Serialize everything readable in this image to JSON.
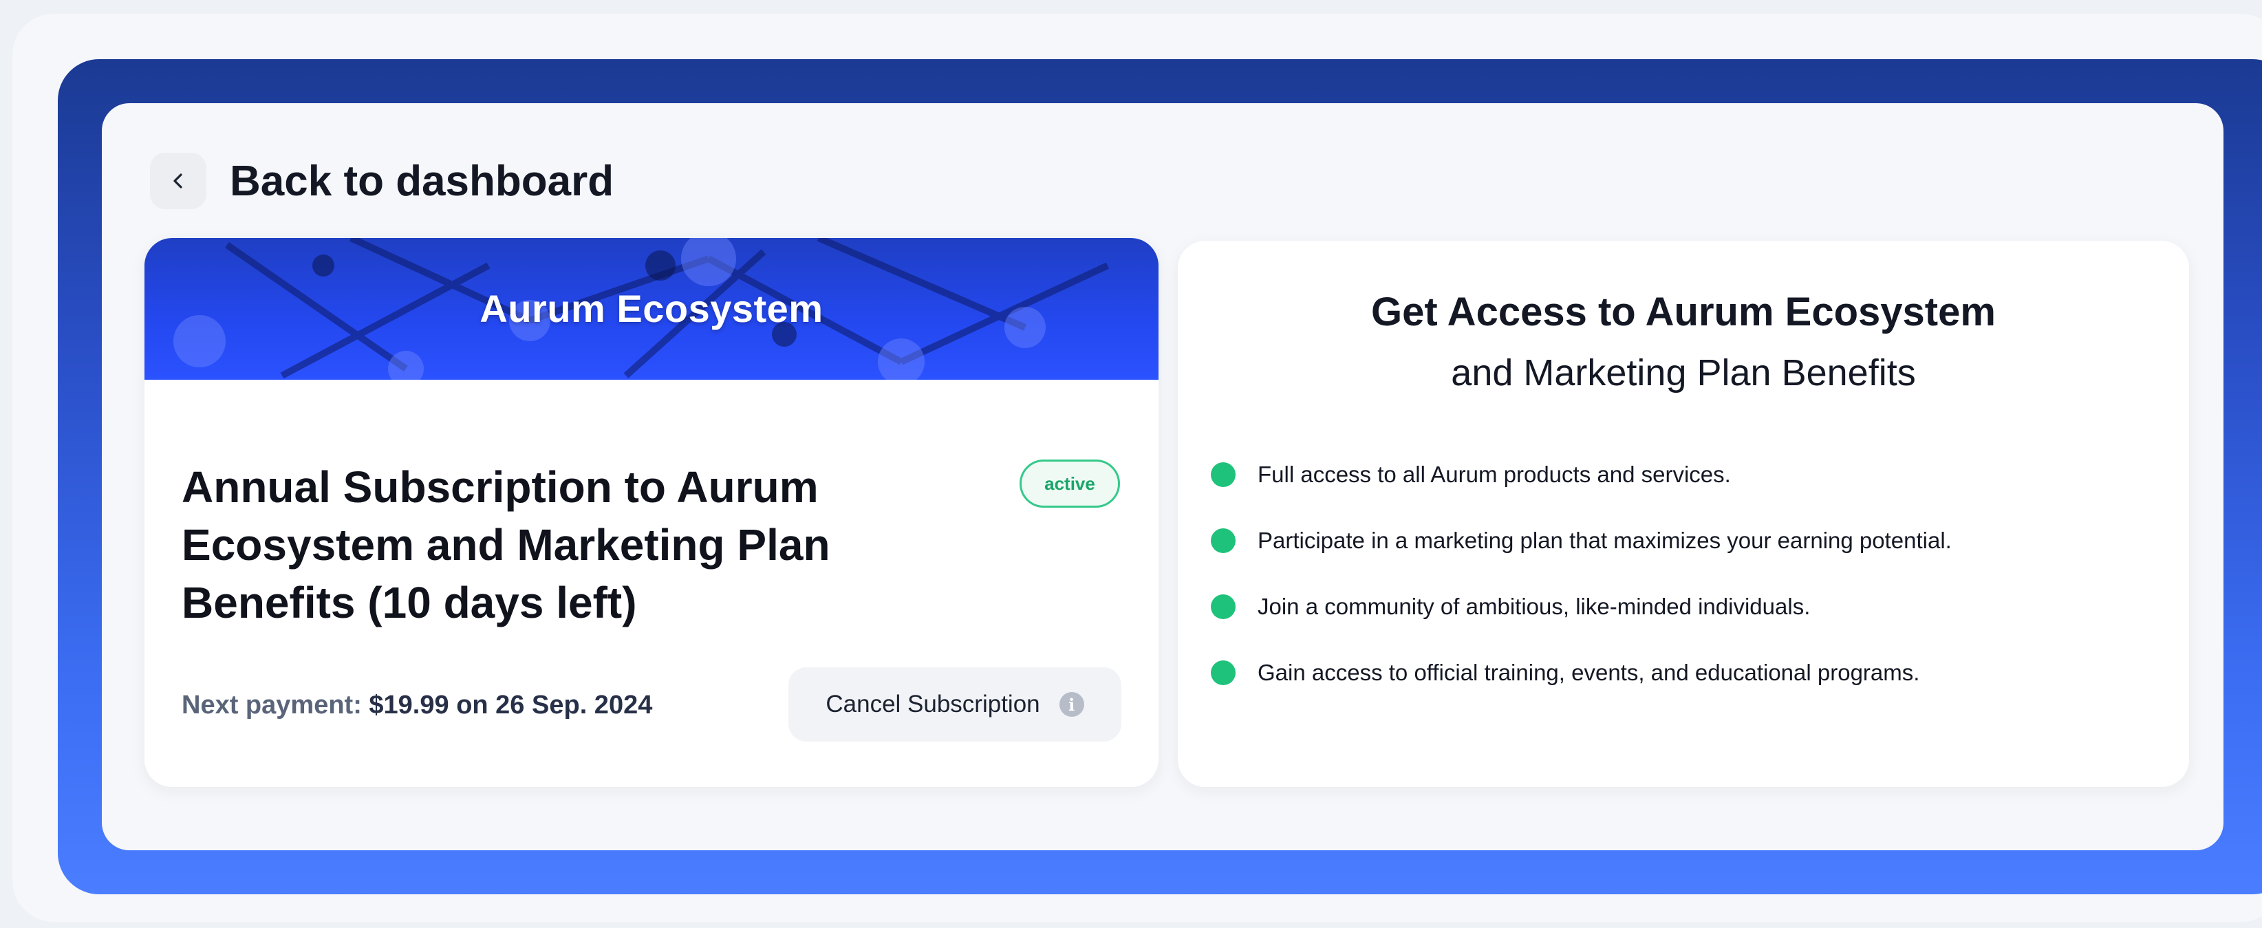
{
  "nav": {
    "back_label": "Back to dashboard"
  },
  "subscription": {
    "banner_title": "Aurum Ecosystem",
    "title": "Annual Subscription to Aurum Ecosystem and Marketing Plan Benefits (10 days left)",
    "status": "active",
    "next_payment_label": "Next payment:",
    "next_payment_value": "$19.99 on 26 Sep. 2024",
    "cancel_label": "Cancel Subscription",
    "info_icon": "info-icon"
  },
  "benefits": {
    "heading_line1": "Get Access to Aurum Ecosystem",
    "heading_line2": "and Marketing Plan Benefits",
    "items": [
      "Full access to all Aurum products and services.",
      "Participate in a marketing plan that maximizes your earning potential.",
      "Join a community of ambitious, like-minded individuals.",
      "Gain access to official training, events, and educational programs."
    ]
  },
  "colors": {
    "accent_blue": "#3c6ef4",
    "status_green": "#1ec27a"
  }
}
